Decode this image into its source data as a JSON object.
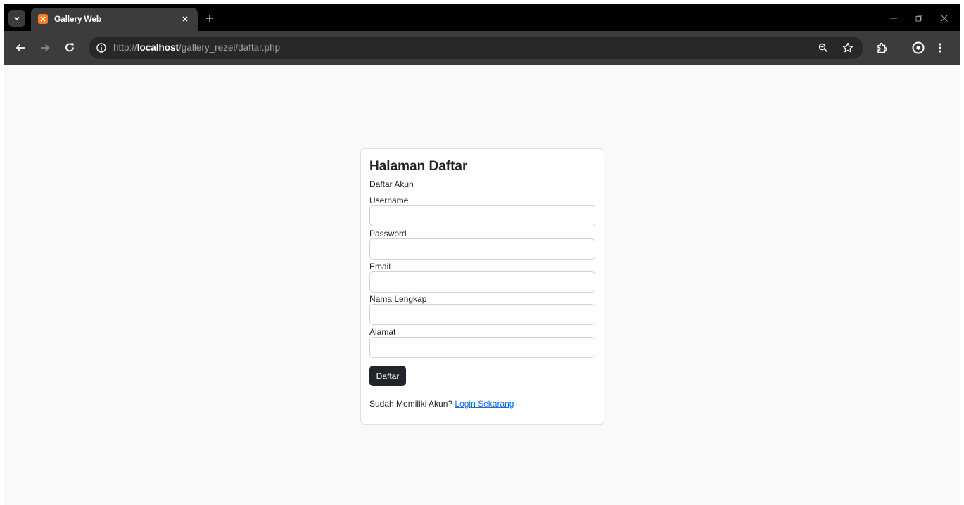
{
  "browser": {
    "tab": {
      "title": "Gallery Web",
      "favicon": "xampp-icon"
    },
    "url": {
      "scheme": "http://",
      "host": "localhost",
      "path": "/gallery_rezel/daftar.php"
    },
    "colors": {
      "frame": "#000000",
      "toolbar": "#3c3c3c",
      "omnibox": "#282828"
    }
  },
  "page": {
    "title": "Halaman Daftar",
    "subtitle": "Daftar Akun",
    "fields": [
      {
        "label": "Username",
        "value": ""
      },
      {
        "label": "Password",
        "value": ""
      },
      {
        "label": "Email",
        "value": ""
      },
      {
        "label": "Nama Lengkap",
        "value": ""
      },
      {
        "label": "Alamat",
        "value": ""
      }
    ],
    "submit_label": "Daftar",
    "footer_text": "Sudah Memiliki Akun?",
    "footer_link": "Login Sekarang",
    "colors": {
      "background": "#f8f9fa",
      "button": "#212529",
      "link": "#0d6efd"
    }
  }
}
